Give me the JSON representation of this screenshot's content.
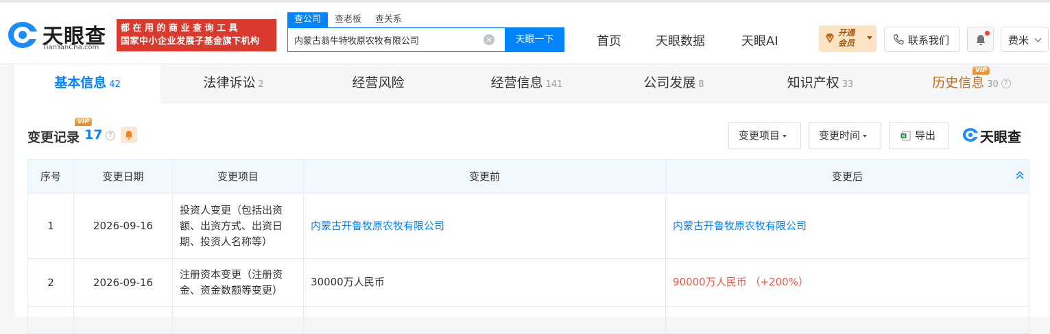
{
  "header": {
    "logo_name": "天眼查",
    "logo_sub": "TianYanCha.com",
    "promo_line1": "都在用的商业查询工具",
    "promo_line2": "国家中小企业发展子基金旗下机构",
    "search_tabs": [
      "查公司",
      "查老板",
      "查关系"
    ],
    "search_value": "内蒙古翁牛特牧原农牧有限公司",
    "search_button": "天眼一下",
    "nav": [
      "首页",
      "天眼数据",
      "天眼AI"
    ],
    "vip_line1": "开通",
    "vip_line2": "会员",
    "contact": "联系我们",
    "user": "费米"
  },
  "tabs": [
    {
      "label": "基本信息",
      "count": "42"
    },
    {
      "label": "法律诉讼",
      "count": "2"
    },
    {
      "label": "经营风险",
      "count": ""
    },
    {
      "label": "经营信息",
      "count": "141"
    },
    {
      "label": "公司发展",
      "count": "8"
    },
    {
      "label": "知识产权",
      "count": "33"
    },
    {
      "label": "历史信息",
      "count": "30"
    }
  ],
  "vip_tag": "VIP",
  "section": {
    "title": "变更记录",
    "count": "17",
    "filter_item": "变更项目",
    "filter_time": "变更时间",
    "export": "导出",
    "brand": "天眼查"
  },
  "table": {
    "headers": [
      "序号",
      "变更日期",
      "变更项目",
      "变更前",
      "变更后"
    ],
    "rows": [
      {
        "no": "1",
        "date": "2026-09-16",
        "item": "投资人变更（包括出资额、出资方式、出资日期、投资人名称等）",
        "before": "内蒙古开鲁牧原农牧有限公司",
        "after": "内蒙古开鲁牧原农牧有限公司"
      },
      {
        "no": "2",
        "date": "2026-09-16",
        "item": "注册资本变更（注册资金、资金数额等变更）",
        "before": "30000万人民币",
        "after": "90000万人民币 （+200%）"
      }
    ]
  },
  "colors": {
    "accent": "#0084ff",
    "promo": "#d93a2e",
    "increase": "#e95a47"
  }
}
